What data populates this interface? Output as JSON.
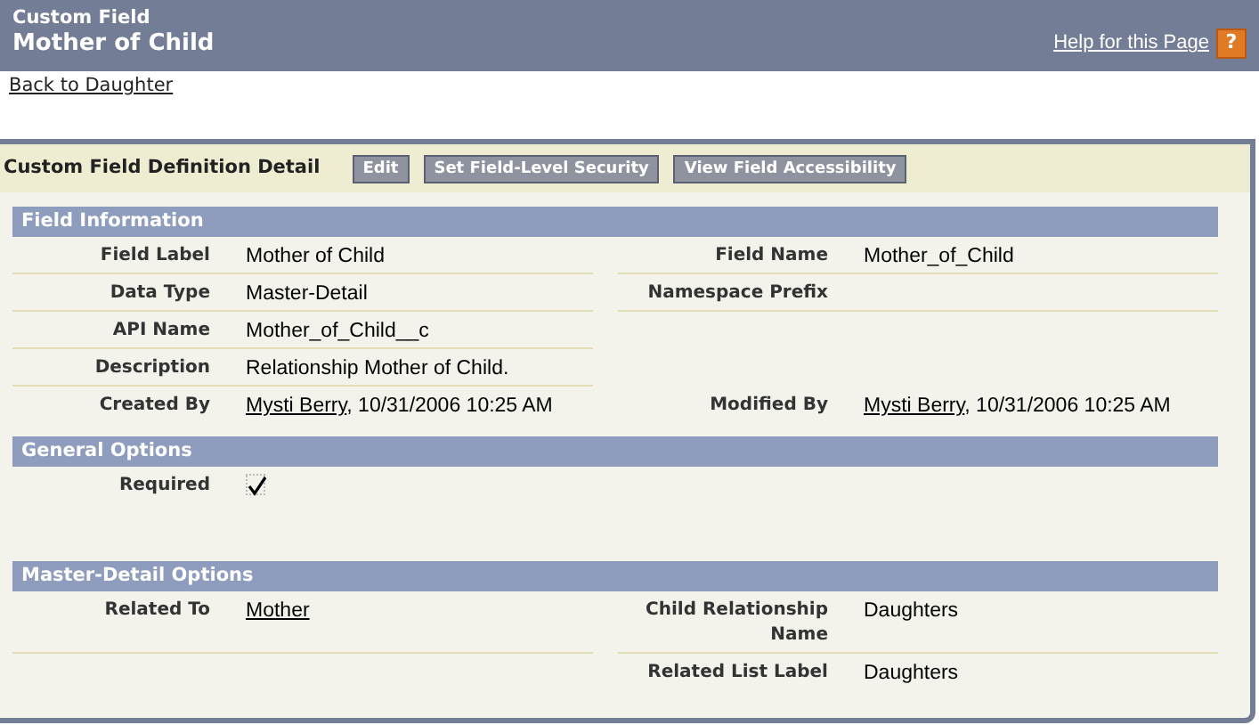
{
  "header": {
    "type": "Custom Field",
    "title": "Mother of Child",
    "help_link": "Help for this Page",
    "help_icon": "?"
  },
  "back_link": "Back to Daughter",
  "detail": {
    "title": "Custom Field Definition Detail",
    "buttons": [
      "Edit",
      "Set Field-Level Security",
      "View Field Accessibility"
    ],
    "sections": [
      {
        "title": "Field Information",
        "rows": [
          {
            "left": {
              "label": "Field Label",
              "value": "Mother of Child"
            },
            "right": {
              "label": "Field Name",
              "value": "Mother_of_Child"
            }
          },
          {
            "left": {
              "label": "Data Type",
              "value": "Master-Detail"
            },
            "right": {
              "label": "Namespace Prefix"
            }
          },
          {
            "left": {
              "label": "API Name",
              "value": "Mother_of_Child__c"
            }
          },
          {
            "left": {
              "label": "Description",
              "value": "Relationship Mother of Child."
            }
          },
          {
            "left": {
              "label": "Created By",
              "link": "Mysti Berry",
              "value": ", 10/31/2006 10:25 AM"
            },
            "right": {
              "label": "Modified By",
              "link": "Mysti Berry",
              "value": ", 10/31/2006 10:25 AM"
            }
          }
        ]
      },
      {
        "title": "General Options",
        "rows": [
          {
            "left": {
              "label": "Required",
              "kind": "check",
              "checked": true
            }
          }
        ]
      },
      {
        "title": "Master-Detail Options",
        "rows": [
          {
            "left": {
              "label": "Related To",
              "link": "Mother"
            },
            "right": {
              "label": "Child Relationship Name",
              "value": "Daughters"
            }
          },
          {
            "right": {
              "label": "Related List Label",
              "value": "Daughters"
            }
          }
        ]
      }
    ]
  }
}
